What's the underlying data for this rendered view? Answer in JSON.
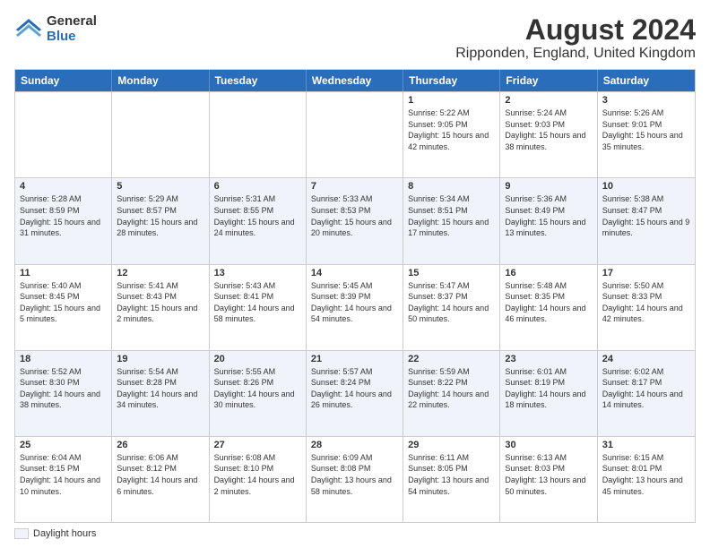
{
  "logo": {
    "general": "General",
    "blue": "Blue"
  },
  "title": "August 2024",
  "location": "Ripponden, England, United Kingdom",
  "headers": [
    "Sunday",
    "Monday",
    "Tuesday",
    "Wednesday",
    "Thursday",
    "Friday",
    "Saturday"
  ],
  "legend_label": "Daylight hours",
  "weeks": [
    [
      {
        "day": "",
        "sunrise": "",
        "sunset": "",
        "daylight": ""
      },
      {
        "day": "",
        "sunrise": "",
        "sunset": "",
        "daylight": ""
      },
      {
        "day": "",
        "sunrise": "",
        "sunset": "",
        "daylight": ""
      },
      {
        "day": "",
        "sunrise": "",
        "sunset": "",
        "daylight": ""
      },
      {
        "day": "1",
        "sunrise": "Sunrise: 5:22 AM",
        "sunset": "Sunset: 9:05 PM",
        "daylight": "Daylight: 15 hours and 42 minutes."
      },
      {
        "day": "2",
        "sunrise": "Sunrise: 5:24 AM",
        "sunset": "Sunset: 9:03 PM",
        "daylight": "Daylight: 15 hours and 38 minutes."
      },
      {
        "day": "3",
        "sunrise": "Sunrise: 5:26 AM",
        "sunset": "Sunset: 9:01 PM",
        "daylight": "Daylight: 15 hours and 35 minutes."
      }
    ],
    [
      {
        "day": "4",
        "sunrise": "Sunrise: 5:28 AM",
        "sunset": "Sunset: 8:59 PM",
        "daylight": "Daylight: 15 hours and 31 minutes."
      },
      {
        "day": "5",
        "sunrise": "Sunrise: 5:29 AM",
        "sunset": "Sunset: 8:57 PM",
        "daylight": "Daylight: 15 hours and 28 minutes."
      },
      {
        "day": "6",
        "sunrise": "Sunrise: 5:31 AM",
        "sunset": "Sunset: 8:55 PM",
        "daylight": "Daylight: 15 hours and 24 minutes."
      },
      {
        "day": "7",
        "sunrise": "Sunrise: 5:33 AM",
        "sunset": "Sunset: 8:53 PM",
        "daylight": "Daylight: 15 hours and 20 minutes."
      },
      {
        "day": "8",
        "sunrise": "Sunrise: 5:34 AM",
        "sunset": "Sunset: 8:51 PM",
        "daylight": "Daylight: 15 hours and 17 minutes."
      },
      {
        "day": "9",
        "sunrise": "Sunrise: 5:36 AM",
        "sunset": "Sunset: 8:49 PM",
        "daylight": "Daylight: 15 hours and 13 minutes."
      },
      {
        "day": "10",
        "sunrise": "Sunrise: 5:38 AM",
        "sunset": "Sunset: 8:47 PM",
        "daylight": "Daylight: 15 hours and 9 minutes."
      }
    ],
    [
      {
        "day": "11",
        "sunrise": "Sunrise: 5:40 AM",
        "sunset": "Sunset: 8:45 PM",
        "daylight": "Daylight: 15 hours and 5 minutes."
      },
      {
        "day": "12",
        "sunrise": "Sunrise: 5:41 AM",
        "sunset": "Sunset: 8:43 PM",
        "daylight": "Daylight: 15 hours and 2 minutes."
      },
      {
        "day": "13",
        "sunrise": "Sunrise: 5:43 AM",
        "sunset": "Sunset: 8:41 PM",
        "daylight": "Daylight: 14 hours and 58 minutes."
      },
      {
        "day": "14",
        "sunrise": "Sunrise: 5:45 AM",
        "sunset": "Sunset: 8:39 PM",
        "daylight": "Daylight: 14 hours and 54 minutes."
      },
      {
        "day": "15",
        "sunrise": "Sunrise: 5:47 AM",
        "sunset": "Sunset: 8:37 PM",
        "daylight": "Daylight: 14 hours and 50 minutes."
      },
      {
        "day": "16",
        "sunrise": "Sunrise: 5:48 AM",
        "sunset": "Sunset: 8:35 PM",
        "daylight": "Daylight: 14 hours and 46 minutes."
      },
      {
        "day": "17",
        "sunrise": "Sunrise: 5:50 AM",
        "sunset": "Sunset: 8:33 PM",
        "daylight": "Daylight: 14 hours and 42 minutes."
      }
    ],
    [
      {
        "day": "18",
        "sunrise": "Sunrise: 5:52 AM",
        "sunset": "Sunset: 8:30 PM",
        "daylight": "Daylight: 14 hours and 38 minutes."
      },
      {
        "day": "19",
        "sunrise": "Sunrise: 5:54 AM",
        "sunset": "Sunset: 8:28 PM",
        "daylight": "Daylight: 14 hours and 34 minutes."
      },
      {
        "day": "20",
        "sunrise": "Sunrise: 5:55 AM",
        "sunset": "Sunset: 8:26 PM",
        "daylight": "Daylight: 14 hours and 30 minutes."
      },
      {
        "day": "21",
        "sunrise": "Sunrise: 5:57 AM",
        "sunset": "Sunset: 8:24 PM",
        "daylight": "Daylight: 14 hours and 26 minutes."
      },
      {
        "day": "22",
        "sunrise": "Sunrise: 5:59 AM",
        "sunset": "Sunset: 8:22 PM",
        "daylight": "Daylight: 14 hours and 22 minutes."
      },
      {
        "day": "23",
        "sunrise": "Sunrise: 6:01 AM",
        "sunset": "Sunset: 8:19 PM",
        "daylight": "Daylight: 14 hours and 18 minutes."
      },
      {
        "day": "24",
        "sunrise": "Sunrise: 6:02 AM",
        "sunset": "Sunset: 8:17 PM",
        "daylight": "Daylight: 14 hours and 14 minutes."
      }
    ],
    [
      {
        "day": "25",
        "sunrise": "Sunrise: 6:04 AM",
        "sunset": "Sunset: 8:15 PM",
        "daylight": "Daylight: 14 hours and 10 minutes."
      },
      {
        "day": "26",
        "sunrise": "Sunrise: 6:06 AM",
        "sunset": "Sunset: 8:12 PM",
        "daylight": "Daylight: 14 hours and 6 minutes."
      },
      {
        "day": "27",
        "sunrise": "Sunrise: 6:08 AM",
        "sunset": "Sunset: 8:10 PM",
        "daylight": "Daylight: 14 hours and 2 minutes."
      },
      {
        "day": "28",
        "sunrise": "Sunrise: 6:09 AM",
        "sunset": "Sunset: 8:08 PM",
        "daylight": "Daylight: 13 hours and 58 minutes."
      },
      {
        "day": "29",
        "sunrise": "Sunrise: 6:11 AM",
        "sunset": "Sunset: 8:05 PM",
        "daylight": "Daylight: 13 hours and 54 minutes."
      },
      {
        "day": "30",
        "sunrise": "Sunrise: 6:13 AM",
        "sunset": "Sunset: 8:03 PM",
        "daylight": "Daylight: 13 hours and 50 minutes."
      },
      {
        "day": "31",
        "sunrise": "Sunrise: 6:15 AM",
        "sunset": "Sunset: 8:01 PM",
        "daylight": "Daylight: 13 hours and 45 minutes."
      }
    ]
  ]
}
